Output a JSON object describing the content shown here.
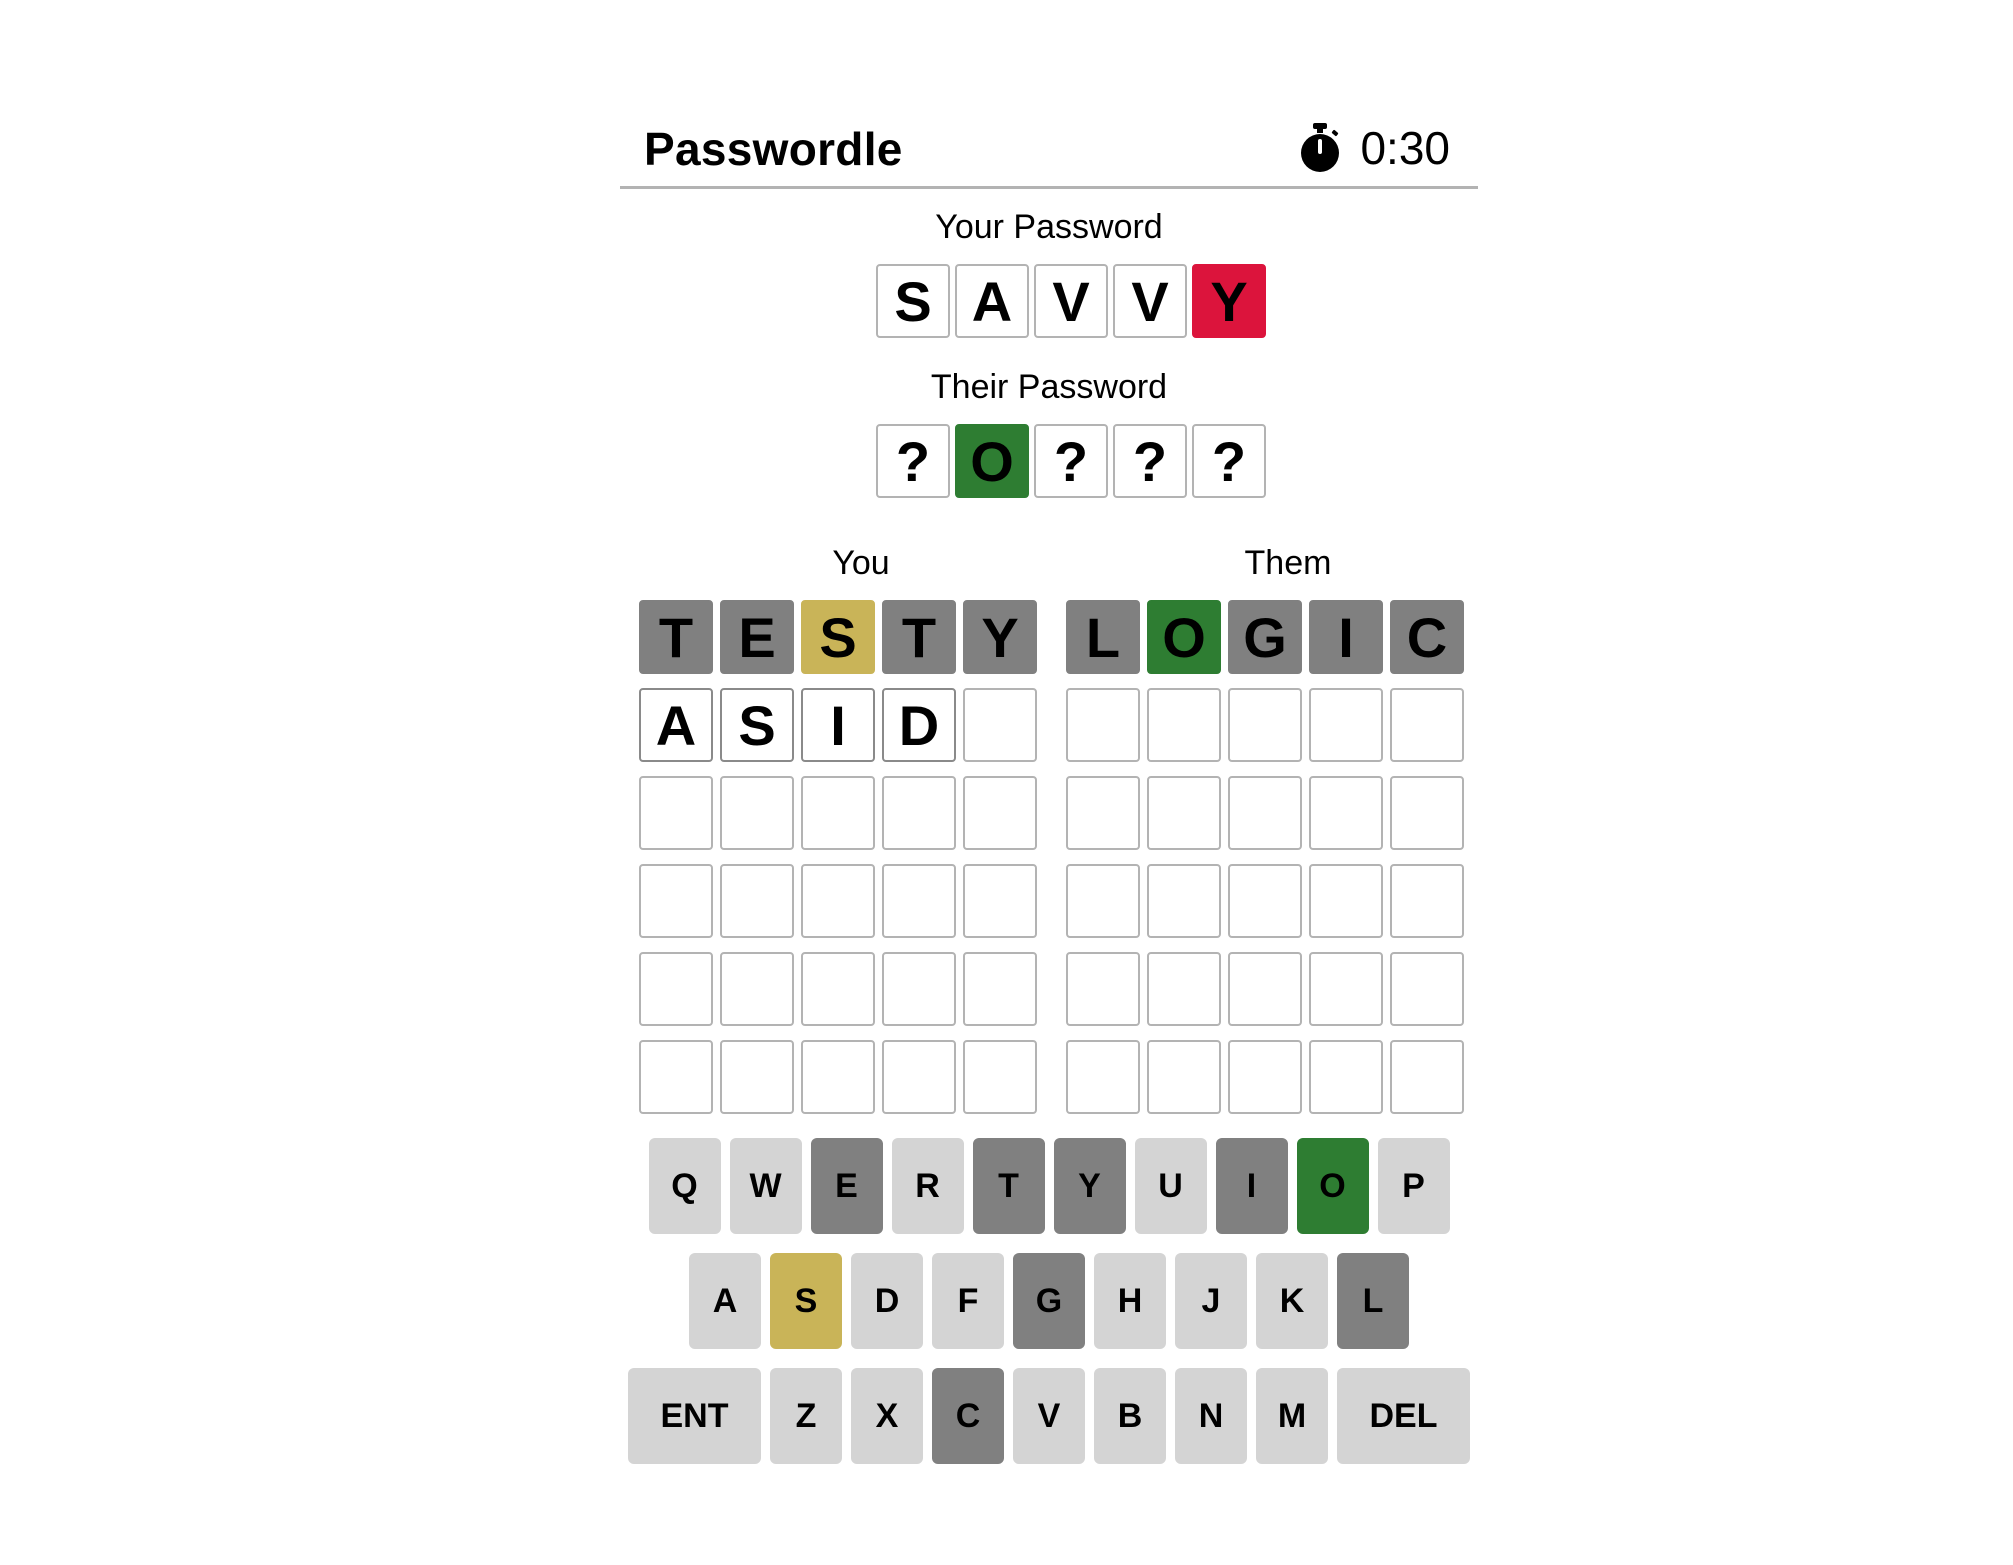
{
  "header": {
    "title": "Passwordle",
    "timer": "0:30",
    "timer_icon": "stopwatch-icon"
  },
  "your_password": {
    "label": "Your Password",
    "tiles": [
      {
        "letter": "S",
        "state": "empty"
      },
      {
        "letter": "A",
        "state": "empty"
      },
      {
        "letter": "V",
        "state": "empty"
      },
      {
        "letter": "V",
        "state": "empty"
      },
      {
        "letter": "Y",
        "state": "red"
      }
    ]
  },
  "their_password": {
    "label": "Their Password",
    "tiles": [
      {
        "letter": "?",
        "state": "empty"
      },
      {
        "letter": "O",
        "state": "green"
      },
      {
        "letter": "?",
        "state": "empty"
      },
      {
        "letter": "?",
        "state": "empty"
      },
      {
        "letter": "?",
        "state": "empty"
      }
    ]
  },
  "boards": {
    "you": {
      "label": "You",
      "rows": [
        [
          {
            "l": "T",
            "s": "gray"
          },
          {
            "l": "E",
            "s": "gray"
          },
          {
            "l": "S",
            "s": "yellow"
          },
          {
            "l": "T",
            "s": "gray"
          },
          {
            "l": "Y",
            "s": "gray"
          }
        ],
        [
          {
            "l": "A",
            "s": "filled"
          },
          {
            "l": "S",
            "s": "filled"
          },
          {
            "l": "I",
            "s": "filled"
          },
          {
            "l": "D",
            "s": "filled"
          },
          {
            "l": "",
            "s": "empty"
          }
        ],
        [
          {
            "l": "",
            "s": "empty"
          },
          {
            "l": "",
            "s": "empty"
          },
          {
            "l": "",
            "s": "empty"
          },
          {
            "l": "",
            "s": "empty"
          },
          {
            "l": "",
            "s": "empty"
          }
        ],
        [
          {
            "l": "",
            "s": "empty"
          },
          {
            "l": "",
            "s": "empty"
          },
          {
            "l": "",
            "s": "empty"
          },
          {
            "l": "",
            "s": "empty"
          },
          {
            "l": "",
            "s": "empty"
          }
        ],
        [
          {
            "l": "",
            "s": "empty"
          },
          {
            "l": "",
            "s": "empty"
          },
          {
            "l": "",
            "s": "empty"
          },
          {
            "l": "",
            "s": "empty"
          },
          {
            "l": "",
            "s": "empty"
          }
        ],
        [
          {
            "l": "",
            "s": "empty"
          },
          {
            "l": "",
            "s": "empty"
          },
          {
            "l": "",
            "s": "empty"
          },
          {
            "l": "",
            "s": "empty"
          },
          {
            "l": "",
            "s": "empty"
          }
        ]
      ]
    },
    "them": {
      "label": "Them",
      "rows": [
        [
          {
            "l": "L",
            "s": "gray"
          },
          {
            "l": "O",
            "s": "green"
          },
          {
            "l": "G",
            "s": "gray"
          },
          {
            "l": "I",
            "s": "gray"
          },
          {
            "l": "C",
            "s": "gray"
          }
        ],
        [
          {
            "l": "",
            "s": "empty"
          },
          {
            "l": "",
            "s": "empty"
          },
          {
            "l": "",
            "s": "empty"
          },
          {
            "l": "",
            "s": "empty"
          },
          {
            "l": "",
            "s": "empty"
          }
        ],
        [
          {
            "l": "",
            "s": "empty"
          },
          {
            "l": "",
            "s": "empty"
          },
          {
            "l": "",
            "s": "empty"
          },
          {
            "l": "",
            "s": "empty"
          },
          {
            "l": "",
            "s": "empty"
          }
        ],
        [
          {
            "l": "",
            "s": "empty"
          },
          {
            "l": "",
            "s": "empty"
          },
          {
            "l": "",
            "s": "empty"
          },
          {
            "l": "",
            "s": "empty"
          },
          {
            "l": "",
            "s": "empty"
          }
        ],
        [
          {
            "l": "",
            "s": "empty"
          },
          {
            "l": "",
            "s": "empty"
          },
          {
            "l": "",
            "s": "empty"
          },
          {
            "l": "",
            "s": "empty"
          },
          {
            "l": "",
            "s": "empty"
          }
        ],
        [
          {
            "l": "",
            "s": "empty"
          },
          {
            "l": "",
            "s": "empty"
          },
          {
            "l": "",
            "s": "empty"
          },
          {
            "l": "",
            "s": "empty"
          },
          {
            "l": "",
            "s": "empty"
          }
        ]
      ]
    }
  },
  "keyboard": {
    "rows": [
      [
        {
          "k": "Q",
          "s": "default"
        },
        {
          "k": "W",
          "s": "default"
        },
        {
          "k": "E",
          "s": "gray"
        },
        {
          "k": "R",
          "s": "default"
        },
        {
          "k": "T",
          "s": "gray"
        },
        {
          "k": "Y",
          "s": "gray"
        },
        {
          "k": "U",
          "s": "default"
        },
        {
          "k": "I",
          "s": "gray"
        },
        {
          "k": "O",
          "s": "green"
        },
        {
          "k": "P",
          "s": "default"
        }
      ],
      [
        {
          "k": "A",
          "s": "default"
        },
        {
          "k": "S",
          "s": "yellow"
        },
        {
          "k": "D",
          "s": "default"
        },
        {
          "k": "F",
          "s": "default"
        },
        {
          "k": "G",
          "s": "gray"
        },
        {
          "k": "H",
          "s": "default"
        },
        {
          "k": "J",
          "s": "default"
        },
        {
          "k": "K",
          "s": "default"
        },
        {
          "k": "L",
          "s": "gray"
        }
      ],
      [
        {
          "k": "ENT",
          "s": "default",
          "wide": true
        },
        {
          "k": "Z",
          "s": "default"
        },
        {
          "k": "X",
          "s": "default"
        },
        {
          "k": "C",
          "s": "gray"
        },
        {
          "k": "V",
          "s": "default"
        },
        {
          "k": "B",
          "s": "default"
        },
        {
          "k": "N",
          "s": "default"
        },
        {
          "k": "M",
          "s": "default"
        },
        {
          "k": "DEL",
          "s": "default",
          "wide": true
        }
      ]
    ]
  },
  "colors": {
    "green": "#2e7d32",
    "yellow": "#c9b458",
    "gray": "#808080",
    "red": "#dc143c",
    "key": "#d4d4d4"
  }
}
